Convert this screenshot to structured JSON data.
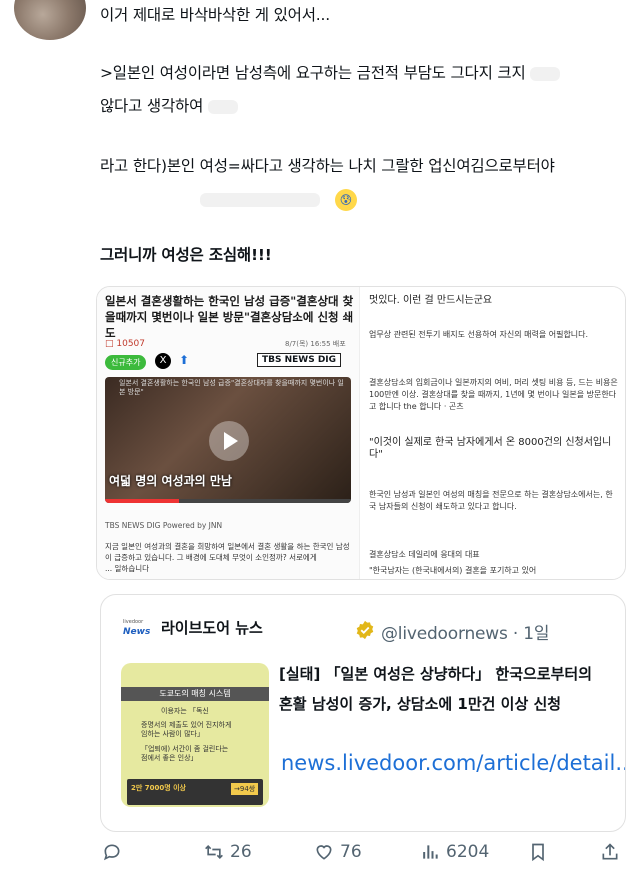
{
  "tweet": {
    "line1": "이거 제대로 바삭바삭한 게 있어서...",
    "line2": ">일본인 여성이라면 남성측에 요구하는 금전적 부담도 그다지 크지",
    "line3": "않다고 생각하여",
    "line4": "라고 한다)본인 여성=싸다고 생각하는 나치 그랄한 업신여김으로부터야",
    "line5_emoji": "anxious-face-emoji",
    "line6": "그러니까 여성은 조심해!!!"
  },
  "media": {
    "left": {
      "headline": "일본서 결혼생활하는 한국인 남성 급증\"결혼상대 찾을때까지 몇번이나 일본 방문\"결혼상담소에 신청 쇄도",
      "views": "10507",
      "date": "8/7(목) 16:55 배포",
      "chip": "신규추가",
      "tbs_label": "TBS NEWS DIG",
      "video_top": "일본서 결혼생활하는 한국인 남성 급증\"결혼상대자를 찾을때까지 몇번이나 일본 방문\"",
      "video_caption": "여덟 명의 여성과의 만남",
      "credit": "TBS NEWS DIG Powered by JNN",
      "body1": "지금 일본인 여성과의 결혼을 희망하여 일본에서 결혼 생활을 하는 한국인 남성이 급증하고 있습니다. 그 배경에 도대체 무엇이 소인정까? 서로에게",
      "body2": "... 일하습니다"
    },
    "right": {
      "t1": "멋있다. 이런 걸 만드시는군요",
      "t2": "업무상 관련된 전투기 배지도 선용하여 자신의 매력을 어필합니다.",
      "t3": "결혼상담소의 입회금이나 일본까지의 여비, 머리 셋팅 비용 등, 드는 비용은 100만엔 이상. 결혼상대를 찾을 때까지, 1년에 몇 번이나 일본을 방문한다고 합니다 the 합니다 · 곤츠",
      "t4": "\"이것이 실제로 한국 남자에게서 온 8000건의 신청서입니다\"",
      "t5": "한국인 남성과 일본인 여성의 매칭을 전문으로 하는 결혼상담소에서는, 한국 남자들의 신청이 쇄도하고 있다고 합니다.",
      "t6": "결혼상담소 데일리에 응대의 대표",
      "t7": "\"한국남자는 (한국내에서의) 결혼을 포기하고 있어"
    }
  },
  "card": {
    "logo_small": "livedoor",
    "logo": "News",
    "name": "라이브도어 뉴스",
    "handle": "@livedoornews · 1일",
    "thumb_title": "도쿄도의 매칭 시스템",
    "thumb_l1": "이용자는 「독신",
    "thumb_l2": "증명서의 제출도 있어 진지하게",
    "thumb_l3": "임하는 사람이 많다」",
    "thumb_l4": "「업퇴에) 서간이 좀 걸린다는",
    "thumb_l5": "점에서 좋은 인상」",
    "thumb_band": "2만 7000명 이상",
    "thumb_badge": "→94쌍",
    "title": "[실태] 「일본 여성은 상냥하다」 한국으로부터의 혼활 남성이 증가, 상담소에 1만건 이상 신청",
    "url": "news.livedoor.com/article/detail......"
  },
  "actions": {
    "retweets": "26",
    "likes": "76",
    "views": "6204"
  },
  "colors": {
    "link": "#1d6fd6",
    "muted": "#536471"
  }
}
